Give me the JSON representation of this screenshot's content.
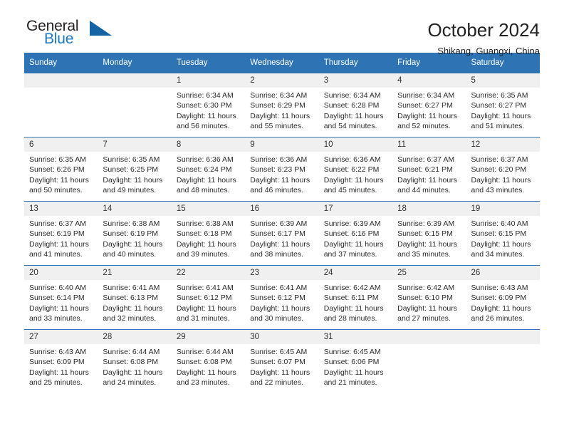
{
  "brand": {
    "name_top": "General",
    "name_bottom": "Blue",
    "accent_color": "#1464a5",
    "text_color": "#231f20",
    "blue_text_color": "#1c7ac0"
  },
  "header": {
    "title": "October 2024",
    "subtitle": "Shikang, Guangxi, China"
  },
  "theme": {
    "header_bar_color": "#2e74b5",
    "daynum_strip_color": "#f0f0f0",
    "body_text_color": "#2b2b2b"
  },
  "weekdays": [
    "Sunday",
    "Monday",
    "Tuesday",
    "Wednesday",
    "Thursday",
    "Friday",
    "Saturday"
  ],
  "labels": {
    "sunrise": "Sunrise:",
    "sunset": "Sunset:",
    "daylight": "Daylight:"
  },
  "weeks": [
    [
      {
        "day": "",
        "empty": true
      },
      {
        "day": "",
        "empty": true
      },
      {
        "day": "1",
        "sunrise": "Sunrise: 6:34 AM",
        "sunset": "Sunset: 6:30 PM",
        "daylight_line1": "Daylight: 11 hours",
        "daylight_line2": "and 56 minutes."
      },
      {
        "day": "2",
        "sunrise": "Sunrise: 6:34 AM",
        "sunset": "Sunset: 6:29 PM",
        "daylight_line1": "Daylight: 11 hours",
        "daylight_line2": "and 55 minutes."
      },
      {
        "day": "3",
        "sunrise": "Sunrise: 6:34 AM",
        "sunset": "Sunset: 6:28 PM",
        "daylight_line1": "Daylight: 11 hours",
        "daylight_line2": "and 54 minutes."
      },
      {
        "day": "4",
        "sunrise": "Sunrise: 6:34 AM",
        "sunset": "Sunset: 6:27 PM",
        "daylight_line1": "Daylight: 11 hours",
        "daylight_line2": "and 52 minutes."
      },
      {
        "day": "5",
        "sunrise": "Sunrise: 6:35 AM",
        "sunset": "Sunset: 6:27 PM",
        "daylight_line1": "Daylight: 11 hours",
        "daylight_line2": "and 51 minutes."
      }
    ],
    [
      {
        "day": "6",
        "sunrise": "Sunrise: 6:35 AM",
        "sunset": "Sunset: 6:26 PM",
        "daylight_line1": "Daylight: 11 hours",
        "daylight_line2": "and 50 minutes."
      },
      {
        "day": "7",
        "sunrise": "Sunrise: 6:35 AM",
        "sunset": "Sunset: 6:25 PM",
        "daylight_line1": "Daylight: 11 hours",
        "daylight_line2": "and 49 minutes."
      },
      {
        "day": "8",
        "sunrise": "Sunrise: 6:36 AM",
        "sunset": "Sunset: 6:24 PM",
        "daylight_line1": "Daylight: 11 hours",
        "daylight_line2": "and 48 minutes."
      },
      {
        "day": "9",
        "sunrise": "Sunrise: 6:36 AM",
        "sunset": "Sunset: 6:23 PM",
        "daylight_line1": "Daylight: 11 hours",
        "daylight_line2": "and 46 minutes."
      },
      {
        "day": "10",
        "sunrise": "Sunrise: 6:36 AM",
        "sunset": "Sunset: 6:22 PM",
        "daylight_line1": "Daylight: 11 hours",
        "daylight_line2": "and 45 minutes."
      },
      {
        "day": "11",
        "sunrise": "Sunrise: 6:37 AM",
        "sunset": "Sunset: 6:21 PM",
        "daylight_line1": "Daylight: 11 hours",
        "daylight_line2": "and 44 minutes."
      },
      {
        "day": "12",
        "sunrise": "Sunrise: 6:37 AM",
        "sunset": "Sunset: 6:20 PM",
        "daylight_line1": "Daylight: 11 hours",
        "daylight_line2": "and 43 minutes."
      }
    ],
    [
      {
        "day": "13",
        "sunrise": "Sunrise: 6:37 AM",
        "sunset": "Sunset: 6:19 PM",
        "daylight_line1": "Daylight: 11 hours",
        "daylight_line2": "and 41 minutes."
      },
      {
        "day": "14",
        "sunrise": "Sunrise: 6:38 AM",
        "sunset": "Sunset: 6:19 PM",
        "daylight_line1": "Daylight: 11 hours",
        "daylight_line2": "and 40 minutes."
      },
      {
        "day": "15",
        "sunrise": "Sunrise: 6:38 AM",
        "sunset": "Sunset: 6:18 PM",
        "daylight_line1": "Daylight: 11 hours",
        "daylight_line2": "and 39 minutes."
      },
      {
        "day": "16",
        "sunrise": "Sunrise: 6:39 AM",
        "sunset": "Sunset: 6:17 PM",
        "daylight_line1": "Daylight: 11 hours",
        "daylight_line2": "and 38 minutes."
      },
      {
        "day": "17",
        "sunrise": "Sunrise: 6:39 AM",
        "sunset": "Sunset: 6:16 PM",
        "daylight_line1": "Daylight: 11 hours",
        "daylight_line2": "and 37 minutes."
      },
      {
        "day": "18",
        "sunrise": "Sunrise: 6:39 AM",
        "sunset": "Sunset: 6:15 PM",
        "daylight_line1": "Daylight: 11 hours",
        "daylight_line2": "and 35 minutes."
      },
      {
        "day": "19",
        "sunrise": "Sunrise: 6:40 AM",
        "sunset": "Sunset: 6:15 PM",
        "daylight_line1": "Daylight: 11 hours",
        "daylight_line2": "and 34 minutes."
      }
    ],
    [
      {
        "day": "20",
        "sunrise": "Sunrise: 6:40 AM",
        "sunset": "Sunset: 6:14 PM",
        "daylight_line1": "Daylight: 11 hours",
        "daylight_line2": "and 33 minutes."
      },
      {
        "day": "21",
        "sunrise": "Sunrise: 6:41 AM",
        "sunset": "Sunset: 6:13 PM",
        "daylight_line1": "Daylight: 11 hours",
        "daylight_line2": "and 32 minutes."
      },
      {
        "day": "22",
        "sunrise": "Sunrise: 6:41 AM",
        "sunset": "Sunset: 6:12 PM",
        "daylight_line1": "Daylight: 11 hours",
        "daylight_line2": "and 31 minutes."
      },
      {
        "day": "23",
        "sunrise": "Sunrise: 6:41 AM",
        "sunset": "Sunset: 6:12 PM",
        "daylight_line1": "Daylight: 11 hours",
        "daylight_line2": "and 30 minutes."
      },
      {
        "day": "24",
        "sunrise": "Sunrise: 6:42 AM",
        "sunset": "Sunset: 6:11 PM",
        "daylight_line1": "Daylight: 11 hours",
        "daylight_line2": "and 28 minutes."
      },
      {
        "day": "25",
        "sunrise": "Sunrise: 6:42 AM",
        "sunset": "Sunset: 6:10 PM",
        "daylight_line1": "Daylight: 11 hours",
        "daylight_line2": "and 27 minutes."
      },
      {
        "day": "26",
        "sunrise": "Sunrise: 6:43 AM",
        "sunset": "Sunset: 6:09 PM",
        "daylight_line1": "Daylight: 11 hours",
        "daylight_line2": "and 26 minutes."
      }
    ],
    [
      {
        "day": "27",
        "sunrise": "Sunrise: 6:43 AM",
        "sunset": "Sunset: 6:09 PM",
        "daylight_line1": "Daylight: 11 hours",
        "daylight_line2": "and 25 minutes."
      },
      {
        "day": "28",
        "sunrise": "Sunrise: 6:44 AM",
        "sunset": "Sunset: 6:08 PM",
        "daylight_line1": "Daylight: 11 hours",
        "daylight_line2": "and 24 minutes."
      },
      {
        "day": "29",
        "sunrise": "Sunrise: 6:44 AM",
        "sunset": "Sunset: 6:08 PM",
        "daylight_line1": "Daylight: 11 hours",
        "daylight_line2": "and 23 minutes."
      },
      {
        "day": "30",
        "sunrise": "Sunrise: 6:45 AM",
        "sunset": "Sunset: 6:07 PM",
        "daylight_line1": "Daylight: 11 hours",
        "daylight_line2": "and 22 minutes."
      },
      {
        "day": "31",
        "sunrise": "Sunrise: 6:45 AM",
        "sunset": "Sunset: 6:06 PM",
        "daylight_line1": "Daylight: 11 hours",
        "daylight_line2": "and 21 minutes."
      },
      {
        "day": "",
        "empty": true
      },
      {
        "day": "",
        "empty": true
      }
    ]
  ]
}
